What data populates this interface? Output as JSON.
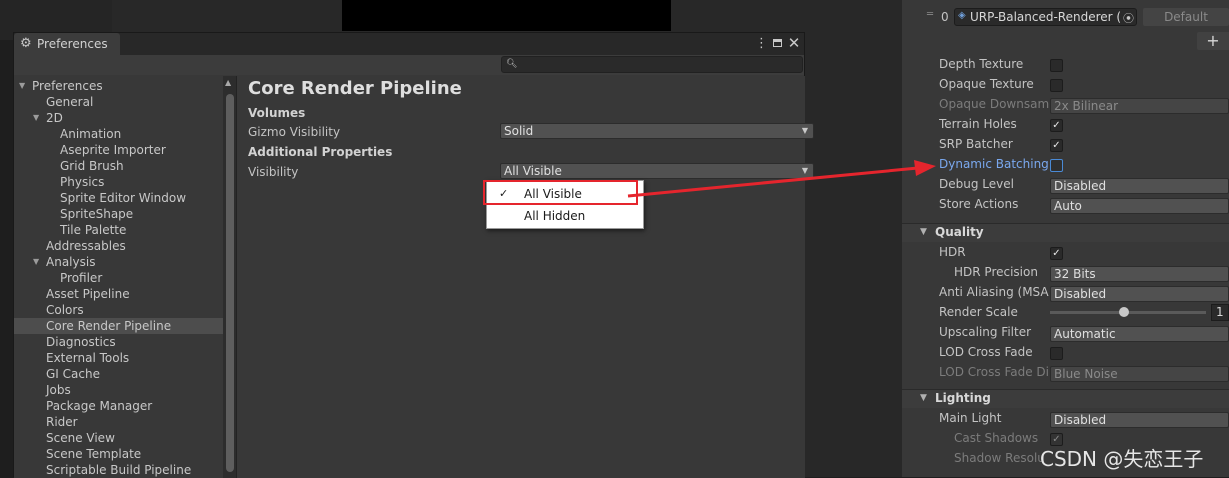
{
  "preferences": {
    "window_title": "Preferences",
    "tree": [
      {
        "label": "Preferences",
        "expanded": true
      },
      {
        "label": "General"
      },
      {
        "label": "2D",
        "expanded": true
      },
      {
        "label": "Animation"
      },
      {
        "label": "Aseprite Importer"
      },
      {
        "label": "Grid Brush"
      },
      {
        "label": "Physics"
      },
      {
        "label": "Sprite Editor Window"
      },
      {
        "label": "SpriteShape"
      },
      {
        "label": "Tile Palette"
      },
      {
        "label": "Addressables"
      },
      {
        "label": "Analysis",
        "expanded": true
      },
      {
        "label": "Profiler"
      },
      {
        "label": "Asset Pipeline"
      },
      {
        "label": "Colors"
      },
      {
        "label": "Core Render Pipeline",
        "selected": true
      },
      {
        "label": "Diagnostics"
      },
      {
        "label": "External Tools"
      },
      {
        "label": "GI Cache"
      },
      {
        "label": "Jobs"
      },
      {
        "label": "Package Manager"
      },
      {
        "label": "Rider"
      },
      {
        "label": "Scene View"
      },
      {
        "label": "Scene Template"
      },
      {
        "label": "Scriptable Build Pipeline"
      }
    ],
    "content": {
      "title": "Core Render Pipeline",
      "volumes_header": "Volumes",
      "gizmo_visibility_label": "Gizmo Visibility",
      "gizmo_visibility_value": "Solid",
      "additional_properties_header": "Additional Properties",
      "visibility_label": "Visibility",
      "visibility_value": "All Visible"
    },
    "popup": {
      "options": [
        "All Visible",
        "All Hidden"
      ],
      "checked": "All Visible"
    }
  },
  "inspector": {
    "renderer_index": "0",
    "renderer_name": "URP-Balanced-Renderer (",
    "default_button": "Default",
    "add_button": "+",
    "rendering_rows": [
      {
        "label": "Depth Texture",
        "type": "checkbox",
        "checked": false
      },
      {
        "label": "Opaque Texture",
        "type": "checkbox",
        "checked": false
      },
      {
        "label": "Opaque Downsamp",
        "type": "dropdown",
        "value": "2x Bilinear",
        "disabled": true
      },
      {
        "label": "Terrain Holes",
        "type": "checkbox",
        "checked": true
      },
      {
        "label": "SRP Batcher",
        "type": "checkbox",
        "checked": true
      },
      {
        "label": "Dynamic Batching",
        "type": "checkbox",
        "checked": false,
        "highlighted": true
      },
      {
        "label": "Debug Level",
        "type": "dropdown",
        "value": "Disabled"
      },
      {
        "label": "Store Actions",
        "type": "dropdown",
        "value": "Auto"
      }
    ],
    "quality_header": "Quality",
    "quality_rows": [
      {
        "label": "HDR",
        "type": "checkbox",
        "checked": true
      },
      {
        "label": "HDR Precision",
        "type": "dropdown",
        "value": "32 Bits",
        "indent": true
      },
      {
        "label": "Anti Aliasing (MSAA",
        "type": "dropdown",
        "value": "Disabled"
      },
      {
        "label": "Render Scale",
        "type": "slider",
        "value": "1"
      },
      {
        "label": "Upscaling Filter",
        "type": "dropdown",
        "value": "Automatic"
      },
      {
        "label": "LOD Cross Fade",
        "type": "checkbox",
        "checked": false
      },
      {
        "label": "LOD Cross Fade Dit",
        "type": "dropdown",
        "value": "Blue Noise",
        "disabled": true
      }
    ],
    "lighting_header": "Lighting",
    "lighting_rows": [
      {
        "label": "Main Light",
        "type": "dropdown",
        "value": "Disabled"
      },
      {
        "label": "Cast Shadows",
        "type": "checkbox",
        "checked": true,
        "disabled": true,
        "indent": true
      },
      {
        "label": "Shadow Resolu",
        "type": "text",
        "disabled": true,
        "indent": true
      }
    ]
  },
  "icons": {
    "settings": "gear-icon",
    "menu": "kebab-menu-icon",
    "maximize": "maximize-icon",
    "close": "close-icon",
    "search": "search-icon",
    "check": "check-icon",
    "target": "object-picker-icon"
  },
  "colors": {
    "annotation_red": "#e5252d",
    "highlight_blue": "#7aa8ee"
  },
  "watermark": "CSDN @失恋王子"
}
